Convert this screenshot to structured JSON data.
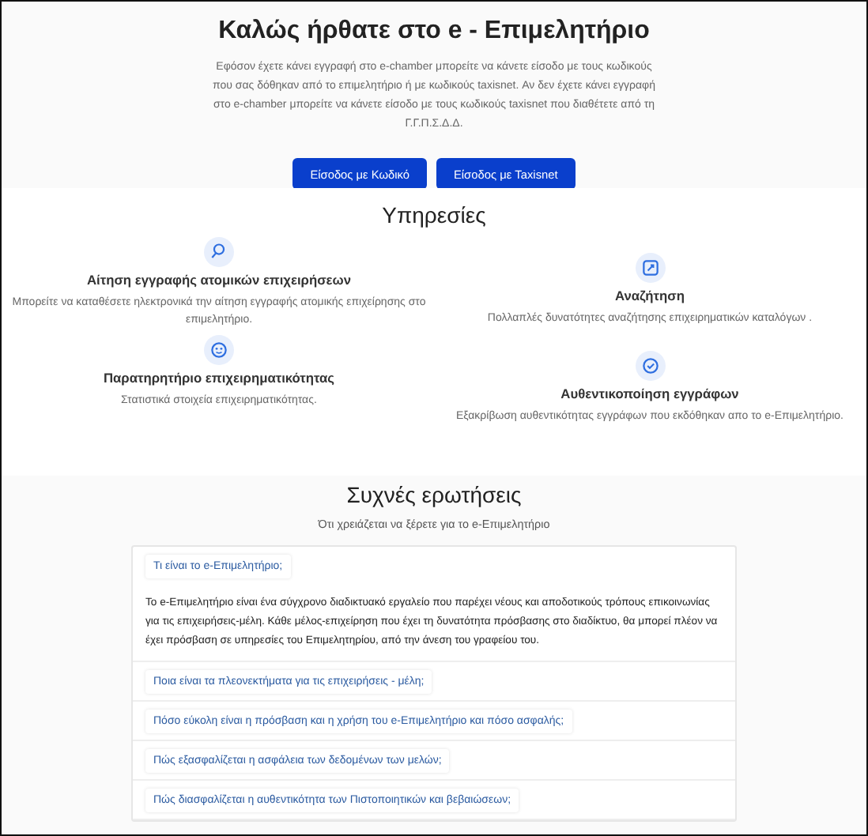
{
  "hero": {
    "title": "Καλώς ήρθατε στο e - Επιμελητήριο",
    "text": "Εφόσον έχετε κάνει εγγραφή στο e-chamber μπορείτε να κάνετε είσοδο με τους κωδικούς που σας δόθηκαν από το επιμελητήριο ή με κωδικούς taxisnet. Αν δεν έχετε κάνει εγγραφή στο e-chamber μπορείτε να κάνετε είσοδο με τους κωδικούς taxisnet που διαθέτετε από τη Γ.Γ.Π.Σ.Δ.Δ.",
    "buttons": [
      "Είσοδος με Κωδικό",
      "Είσοδος με Taxisnet"
    ]
  },
  "services": {
    "title": "Υπηρεσίες",
    "items": [
      {
        "kind": "register",
        "title": "Αίτηση εγγραφής ατομικών επιχειρήσεων",
        "text": "Μπορείτε να καταθέσετε ηλεκτρονικά την αίτηση εγγραφής ατομικής επιχείρησης στο επιμελητήριο."
      },
      {
        "kind": "search",
        "title": "Αναζήτηση",
        "text": "Πολλαπλές δυνατότητες αναζήτησης επιχειρηματικών καταλόγων ."
      },
      {
        "kind": "observatory",
        "title": "Παρατηρητήριο επιχειρηματικότητας",
        "text": "Στατιστικά στοιχεία επιχειρηματικότητας."
      },
      {
        "kind": "verify",
        "title": "Αυθεντικοποίηση εγγράφων",
        "text": "Εξακρίβωση αυθεντικότητας εγγράφων που εκδόθηκαν απο το e-Επιμελητήριο."
      }
    ]
  },
  "faq": {
    "title": "Συχνές ερωτήσεις",
    "subtitle": "Ότι χρειάζεται να ξέρετε για το e-Επιμελητήριο",
    "items": [
      {
        "question": "Τι είναι το e-Επιμελητήριο;",
        "answer": "Το e-Επιμελητήριο είναι ένα σύγχρονο διαδικτυακό εργαλείο που παρέχει νέους και αποδοτικούς τρόπους επικοινωνίας για τις επιχειρήσεις-μέλη. Κάθε μέλος-επιχείρηση που έχει τη δυνατότητα πρόσβασης στο διαδίκτυο, θα μπορεί πλέον να έχει πρόσβαση σε υπηρεσίες του Επιμελητηρίου, από την άνεση του γραφείου του."
      },
      {
        "question": "Ποια είναι τα πλεονεκτήματα για τις επιχειρήσεις - μέλη;"
      },
      {
        "question": "Πόσο εύκολη είναι η πρόσβαση και η χρήση του e-Επιμελητήριο και πόσο ασφαλής;"
      },
      {
        "question": "Πώς εξασφαλίζεται η ασφάλεια των δεδομένων των μελών;"
      },
      {
        "question": "Πώς διασφαλίζεται η αυθεντικότητα των Πιστοποιητικών και βεβαιώσεων;"
      }
    ]
  }
}
